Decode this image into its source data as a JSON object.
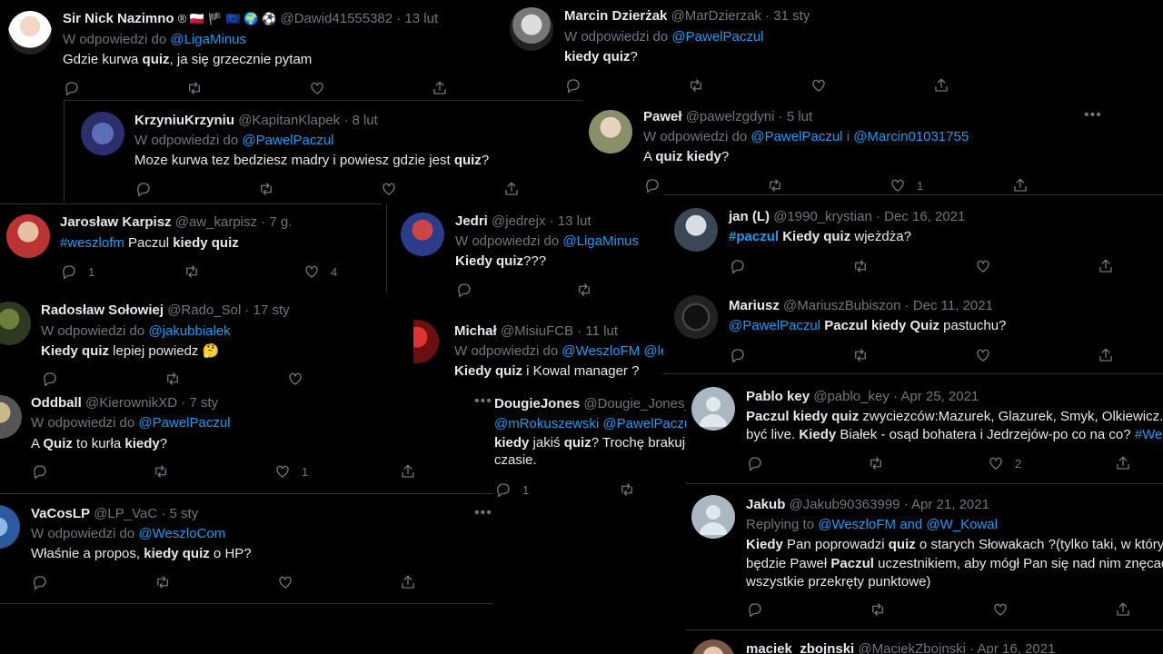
{
  "labels": {
    "in_reply_to": "W odpowiedzi do",
    "replying_to": "Replying to",
    "and": "and",
    "i": "i"
  },
  "tweets": [
    {
      "name": "Sir Nick Nazimno",
      "badges": "® 🇵🇱 🏴 🇪🇺 🌍 ⚽",
      "handle": "@Dawid41555382",
      "date": "· 13 lut",
      "reply_to": "@LigaMinus",
      "text_a": "Gdzie kurwa ",
      "text_b": "quiz",
      "text_c": ", ja się grzecznie pytam"
    },
    {
      "name": "Marcin Dzierżak",
      "handle": "@MarDzierzak",
      "date": "· 31 sty",
      "reply_to": "@PawelPaczul",
      "text_a": "kiedy quiz",
      "text_b": "?"
    },
    {
      "name": "KrzyniuKrzyniu",
      "handle": "@KapitanKlapek",
      "date": "· 8 lut",
      "reply_to": "@PawelPaczul",
      "text_a": "Moze kurwa tez bedziesz madry i powiesz gdzie jest ",
      "text_b": "quiz",
      "text_c": "?"
    },
    {
      "name": "Paweł",
      "handle": "@pawelzgdyni",
      "date": "· 5 lut",
      "reply_to": "@PawelPaczul",
      "reply_to2": "@Marcin01031755",
      "text_a": "A ",
      "text_b": "quiz kiedy",
      "text_c": "?",
      "likes": "1"
    },
    {
      "name": "Jarosław Karpisz",
      "handle": "@aw_karpisz",
      "date": "· 7 g.",
      "hashtag": "#weszlofm",
      "text_a": " Paczul ",
      "text_b": "kiedy quiz",
      "replies": "1",
      "likes": "4"
    },
    {
      "name": "Jedri",
      "handle": "@jedrejx",
      "date": "· 13 lut",
      "reply_to": "@LigaMinus",
      "text_b": "Kiedy quiz",
      "text_c": "???"
    },
    {
      "name": "jan (L)",
      "handle": "@1990_krystian",
      "date": "· Dec 16, 2021",
      "hashtag": "#paczul",
      "text_b": " Kiedy quiz",
      "text_c": " wjeżdża?"
    },
    {
      "name": "Radosław Sołowiej",
      "handle": "@Rado_Sol",
      "date": "· 17 sty",
      "reply_to": "@jakubbialek",
      "text_b": "Kiedy quiz",
      "text_c": " lepiej powiedz 🤔"
    },
    {
      "name": "Michał",
      "handle": "@MisiuFCB",
      "date": "· 11 lut",
      "reply_to": "@WeszloFM @le",
      "text_b": "Kiedy quiz",
      "text_c": " i Kowal manager ?"
    },
    {
      "name": "Mariusz",
      "handle": "@MariuszBubiszon",
      "date": "· Dec 11, 2021",
      "mention": "@PawelPaczul",
      "text_b": " Paczul kiedy Quiz",
      "text_c": " pastuchu?"
    },
    {
      "name": "Oddball",
      "handle": "@KierownikXD",
      "date": "· 7 sty",
      "reply_to": "@PawelPaczul",
      "text_a": "A ",
      "text_b": "Quiz",
      "text_c": " to kurła ",
      "text_d": "kiedy",
      "text_e": "?",
      "likes": "1"
    },
    {
      "name": "DougieJones",
      "handle": "@Dougie_Jones_",
      "mentions": "@mRokuszewski @PawelPaczul",
      "text_b": "kiedy",
      "text_c": " jakiś ",
      "text_d": "quiz",
      "text_e": "? Trochę brakuje",
      "text_f": "czasie.",
      "replies": "1"
    },
    {
      "name": "Pablo key",
      "handle": "@pablo_key",
      "date": "· Apr 25, 2021",
      "text_b": "Paczul kiedy quiz",
      "text_c": " zwyciezców:Mazurek, Glazurek, Smyk, Olkiewicz.",
      "text_d": "być live. ",
      "text_e": "Kiedy",
      "text_f": " Białek - osąd bohatera i Jedrzejów-po co na co? ",
      "hashtag": "#Wes",
      "likes": "2"
    },
    {
      "name": "VaCosLP",
      "handle": "@LP_VaC",
      "date": "· 5 sty",
      "reply_to": "@WeszloCom",
      "text_a": "Właśnie a propos, ",
      "text_b": "kiedy quiz",
      "text_c": " o HP?"
    },
    {
      "name": "Jakub",
      "handle": "@Jakub90363999",
      "date": "· Apr 21, 2021",
      "reply_to": "@WeszloFM",
      "reply_to2": "@W_Kowal",
      "text_b": "Kiedy",
      "text_c": " Pan poprowadzi ",
      "text_d": "quiz",
      "text_e": " o starych Słowakach ?(tylko taki, w który",
      "text_f": "będzie Paweł ",
      "text_g": "Paczul",
      "text_h": " uczestnikiem, aby mógł Pan się nad nim znęcać",
      "text_i": "wszystkie przekręty punktowe)"
    },
    {
      "name": "maciek_zbojnski",
      "handle": "@MaciekZbojnski",
      "date": "· Apr 16, 2021"
    }
  ]
}
